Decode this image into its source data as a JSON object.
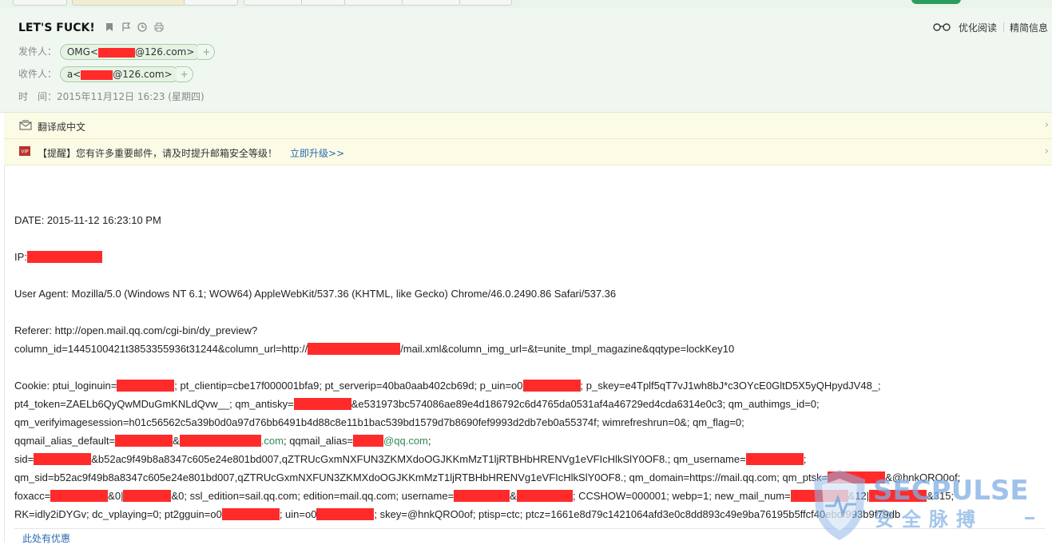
{
  "header": {
    "subject": "LET'S FUCK!",
    "read_mode_label": "优化阅读",
    "simple_info_label": "精简信息",
    "from_label": "发件人：",
    "from_name": "OMG<",
    "from_domain": "@126.com>",
    "to_label": "收件人：",
    "to_name": "a<",
    "to_domain": "@126.com>",
    "time_label": "时　间：",
    "time_value": "2015年11月12日 16:23 (星期四)",
    "add_symbol": "+"
  },
  "translate_bar": {
    "text": "翻译成中文"
  },
  "security_bar": {
    "text": "【提醒】您有许多重要邮件，请及时提升邮箱安全等级！",
    "link": "立即升级>>"
  },
  "body": {
    "date": "DATE: 2015-11-12 16:23:10 PM",
    "ip_label": "IP:",
    "user_agent": "User Agent: Mozilla/5.0 (Windows NT 6.1; WOW64) AppleWebKit/537.36 (KHTML, like Gecko) Chrome/46.0.2490.86 Safari/537.36",
    "referer_1": "Referer: http://open.mail.qq.com/cgi-bin/dy_preview?",
    "referer_2a": "column_id=1445100421t3853355936t31244&column_url=http://",
    "referer_2b": "/mail.xml&column_img_url=&t=unite_tmpl_magazine&qqtype=lockKey10",
    "cookie_1a": "Cookie: ptui_loginuin=",
    "cookie_1b": "; pt_clientip=cbe17f000001bfa9; pt_serverip=40ba0aab402cb69d; p_uin=o0",
    "cookie_1c": "; p_skey=e4Tplf5qT7vJ1wh8bJ*c3OYcE0GltD5X5yQHpydJV48_;",
    "cookie_2a": "pt4_token=ZAELb6QyQwMDuGmKNLdQvw__; qm_antisky=",
    "cookie_2b": "&e531973bc574086ae89e4d186792c6d4765da0531af4a46729ed4cda6314e0c3; qm_authimgs_id=0;",
    "cookie_3": "qm_verifyimagesession=h01c56562c5a39b0d0a97d76bb6491b4d88c8e11b1bac539bd1579d7b8690fef9993d2db7eb0a55374f; wimrefreshrun=0&; qm_flag=0;",
    "cookie_4a": "qqmail_alias_default=",
    "cookie_4b": "&",
    "cookie_4c": ".com",
    "cookie_4d": "; qqmail_alias=",
    "cookie_4e": "@qq.com",
    "cookie_4f": ";",
    "cookie_5a": "sid=",
    "cookie_5b": "&b52ac9f49b8a8347c605e24e801bd007,qZTRUcGxmNXFUN3ZKMXdoOGJKKmMzT1ljRTBHbHRENVg1eVFIcHlkSlY0OF8.; qm_username=",
    "cookie_5c": ";",
    "cookie_6a": "qm_sid=b52ac9f49b8a8347c605e24e801bd007,qZTRUcGxmNXFUN3ZKMXdoOGJKKmMzT1ljRTBHbHRENVg1eVFIcHlkSlY0OF8.; qm_domain=https://mail.qq.com; qm_ptsk=",
    "cookie_6b": "&@hnkQRO0of;",
    "cookie_7a": "foxacc=",
    "cookie_7b": "&0|",
    "cookie_7c": "&0; ssl_edition=sail.qq.com; edition=mail.qq.com; username=",
    "cookie_7d": "&",
    "cookie_7e": "; CCSHOW=000001; webp=1; new_mail_num=",
    "cookie_7f": "&12|",
    "cookie_7g": "&315;",
    "cookie_8a": "RK=idly2iDYGv; dc_vplaying=0; pt2gguin=o0",
    "cookie_8b": "; uin=o0",
    "cookie_8c": "; skey=@hnkQRO0of; ptisp=ctc; ptcz=1661e8d79c1421064afd3e0c8dd893c49e9ba76195b5ffcf40ebdf993b9f79db",
    "more_link": "此处有优惠"
  },
  "watermark": {
    "text": "SECPULSE",
    "subtext": "安全脉搏"
  },
  "colors": {
    "redaction": "#ff2b2b",
    "header_bg": "#f0f7f0",
    "link": "#2a6bb0",
    "accent_green": "#2a9d5c"
  }
}
